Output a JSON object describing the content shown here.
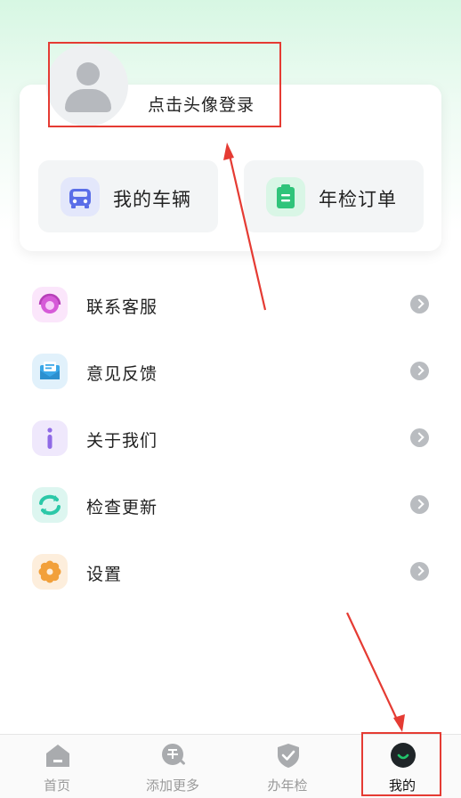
{
  "profile": {
    "login_text": "点击头像登录"
  },
  "quick_actions": [
    {
      "label": "我的车辆",
      "icon": "car-icon",
      "color": "#5a6ee8"
    },
    {
      "label": "年检订单",
      "icon": "clipboard-icon",
      "color": "#2fc47a"
    }
  ],
  "menu": [
    {
      "label": "联系客服",
      "icon": "customer-service-icon",
      "color": "#d65ad8"
    },
    {
      "label": "意见反馈",
      "icon": "mail-icon",
      "color": "#3aa7e8"
    },
    {
      "label": "关于我们",
      "icon": "info-icon",
      "color": "#8f6ae6"
    },
    {
      "label": "检查更新",
      "icon": "refresh-icon",
      "color": "#2cc8a8"
    },
    {
      "label": "设置",
      "icon": "gear-icon",
      "color": "#f2a03a"
    }
  ],
  "tabbar": [
    {
      "label": "首页",
      "icon": "home-icon",
      "active": false
    },
    {
      "label": "添加更多",
      "icon": "violation-icon",
      "active": false
    },
    {
      "label": "办年检",
      "icon": "shield-check-icon",
      "active": false
    },
    {
      "label": "我的",
      "icon": "profile-smile-icon",
      "active": true
    }
  ],
  "colors": {
    "accent_green": "#21c46b",
    "annotation_red": "#e53b33"
  }
}
